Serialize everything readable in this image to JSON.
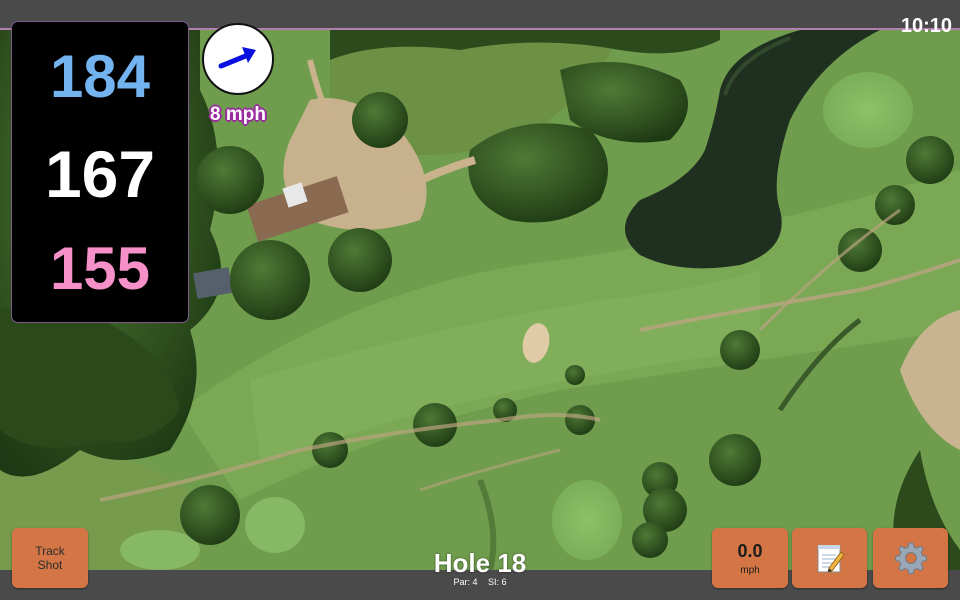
{
  "status_bar": {
    "time": "10:10"
  },
  "distances": {
    "back": "184",
    "middle": "167",
    "front": "155"
  },
  "wind": {
    "speed_label": "8 mph",
    "direction": "east-north-east",
    "arrow_color": "#0a10e0"
  },
  "buttons": {
    "track_shot": {
      "line1": "Track",
      "line2": "Shot"
    },
    "speed": {
      "value": "0.0",
      "unit": "mph"
    },
    "notes": {
      "icon": "notepad-icon"
    },
    "settings": {
      "icon": "gear-icon"
    }
  },
  "hole": {
    "title": "Hole 18",
    "par_label": "Par: 4",
    "si_label": "SI: 6"
  },
  "colors": {
    "button_bg": "#d47545",
    "back_distance": "#73b4f0",
    "middle_distance": "#ffffff",
    "front_distance": "#f590c8",
    "accent": "#b37fb0"
  }
}
